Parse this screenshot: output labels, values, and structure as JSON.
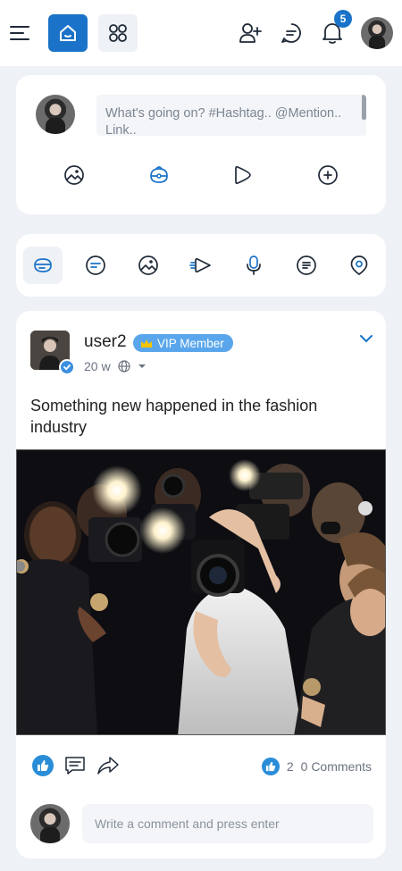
{
  "topbar": {
    "notification_count": "5",
    "accent_color": "#1a73c8"
  },
  "composer": {
    "placeholder": "What's going on? #Hashtag.. @Mention.. Link..",
    "actions": [
      "image-icon",
      "feeling-icon",
      "video-icon",
      "more-icon"
    ]
  },
  "filters": {
    "items": [
      "all-posts-icon",
      "text-posts-icon",
      "photos-icon",
      "videos-icon",
      "audio-icon",
      "files-icon",
      "places-icon"
    ],
    "active_index": 0
  },
  "post": {
    "username": "user2",
    "badge": "VIP Member",
    "time": "20 w",
    "text": "Something new happened in the fashion industry",
    "likes": "2",
    "comments": "0 Comments",
    "comment_placeholder": "Write a comment and press enter"
  }
}
